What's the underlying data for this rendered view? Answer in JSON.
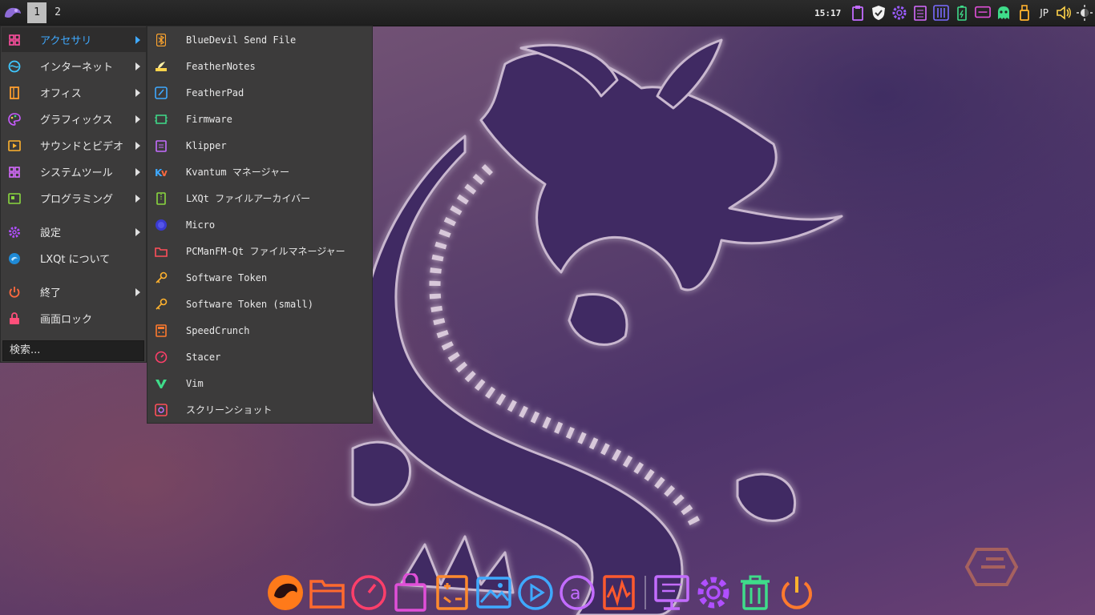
{
  "panel": {
    "workspaces": [
      "1",
      "2"
    ],
    "active_workspace": "1",
    "clock": "15:17",
    "keyboard_layout": "JP",
    "tray_icons": [
      "clipboard-icon",
      "shield-icon",
      "settings-gear-icon",
      "notes-icon",
      "mixer-icon",
      "battery-icon",
      "monitor-icon",
      "ghost-icon",
      "usb-drive-icon",
      "keyboard-layout",
      "volume-icon",
      "brightness-icon"
    ]
  },
  "main_menu": {
    "items": [
      {
        "label": "アクセサリ",
        "icon": "accessories-grid-icon",
        "submenu": true,
        "highlighted": true
      },
      {
        "label": "インターネット",
        "icon": "internet-globe-icon",
        "submenu": true
      },
      {
        "label": "オフィス",
        "icon": "office-book-icon",
        "submenu": true
      },
      {
        "label": "グラフィックス",
        "icon": "graphics-palette-icon",
        "submenu": true
      },
      {
        "label": "サウンドとビデオ",
        "icon": "multimedia-icon",
        "submenu": true
      },
      {
        "label": "システムツール",
        "icon": "system-tools-grid-icon",
        "submenu": true
      },
      {
        "label": "プログラミング",
        "icon": "programming-icon",
        "submenu": true
      },
      {
        "label": "設定",
        "icon": "settings-gear-icon",
        "submenu": true
      },
      {
        "label": "LXQt について",
        "icon": "lxqt-logo-icon",
        "submenu": false
      },
      {
        "label": "終了",
        "icon": "power-icon",
        "submenu": true
      },
      {
        "label": "画面ロック",
        "icon": "lock-icon",
        "submenu": false
      }
    ],
    "search_placeholder": "検索..."
  },
  "submenu": {
    "items": [
      {
        "label": "BlueDevil Send File",
        "icon": "bluetooth-icon"
      },
      {
        "label": "FeatherNotes",
        "icon": "feathernotes-icon"
      },
      {
        "label": "FeatherPad",
        "icon": "featherpad-icon"
      },
      {
        "label": "Firmware",
        "icon": "firmware-chip-icon"
      },
      {
        "label": "Klipper",
        "icon": "clipboard-icon"
      },
      {
        "label": "Kvantum マネージャー",
        "icon": "kvantum-icon"
      },
      {
        "label": "LXQt ファイルアーカイバー",
        "icon": "archive-icon"
      },
      {
        "label": "Micro",
        "icon": "micro-editor-icon"
      },
      {
        "label": "PCManFM-Qt ファイルマネージャー",
        "icon": "folder-icon"
      },
      {
        "label": "Software Token",
        "icon": "key-icon"
      },
      {
        "label": "Software Token (small)",
        "icon": "key-icon"
      },
      {
        "label": "SpeedCrunch",
        "icon": "calculator-icon"
      },
      {
        "label": "Stacer",
        "icon": "stacer-gauge-icon"
      },
      {
        "label": "Vim",
        "icon": "vim-icon"
      },
      {
        "label": "スクリーンショット",
        "icon": "screenshot-icon"
      }
    ]
  },
  "dock": {
    "icons": [
      "garuda-dragon-icon",
      "folder-icon",
      "gauge-icon",
      "store-bag-icon",
      "calculator-icon",
      "image-viewer-icon",
      "media-player-icon",
      "text-editor-a-icon",
      "waveform-icon",
      "remote-desktop-icon",
      "settings-gear-icon",
      "trash-icon",
      "power-icon"
    ]
  },
  "colors": {
    "menu_bg": "#3c3b3b",
    "highlight_text": "#3fa9ff",
    "panel_bg": "#1e1e1e"
  }
}
